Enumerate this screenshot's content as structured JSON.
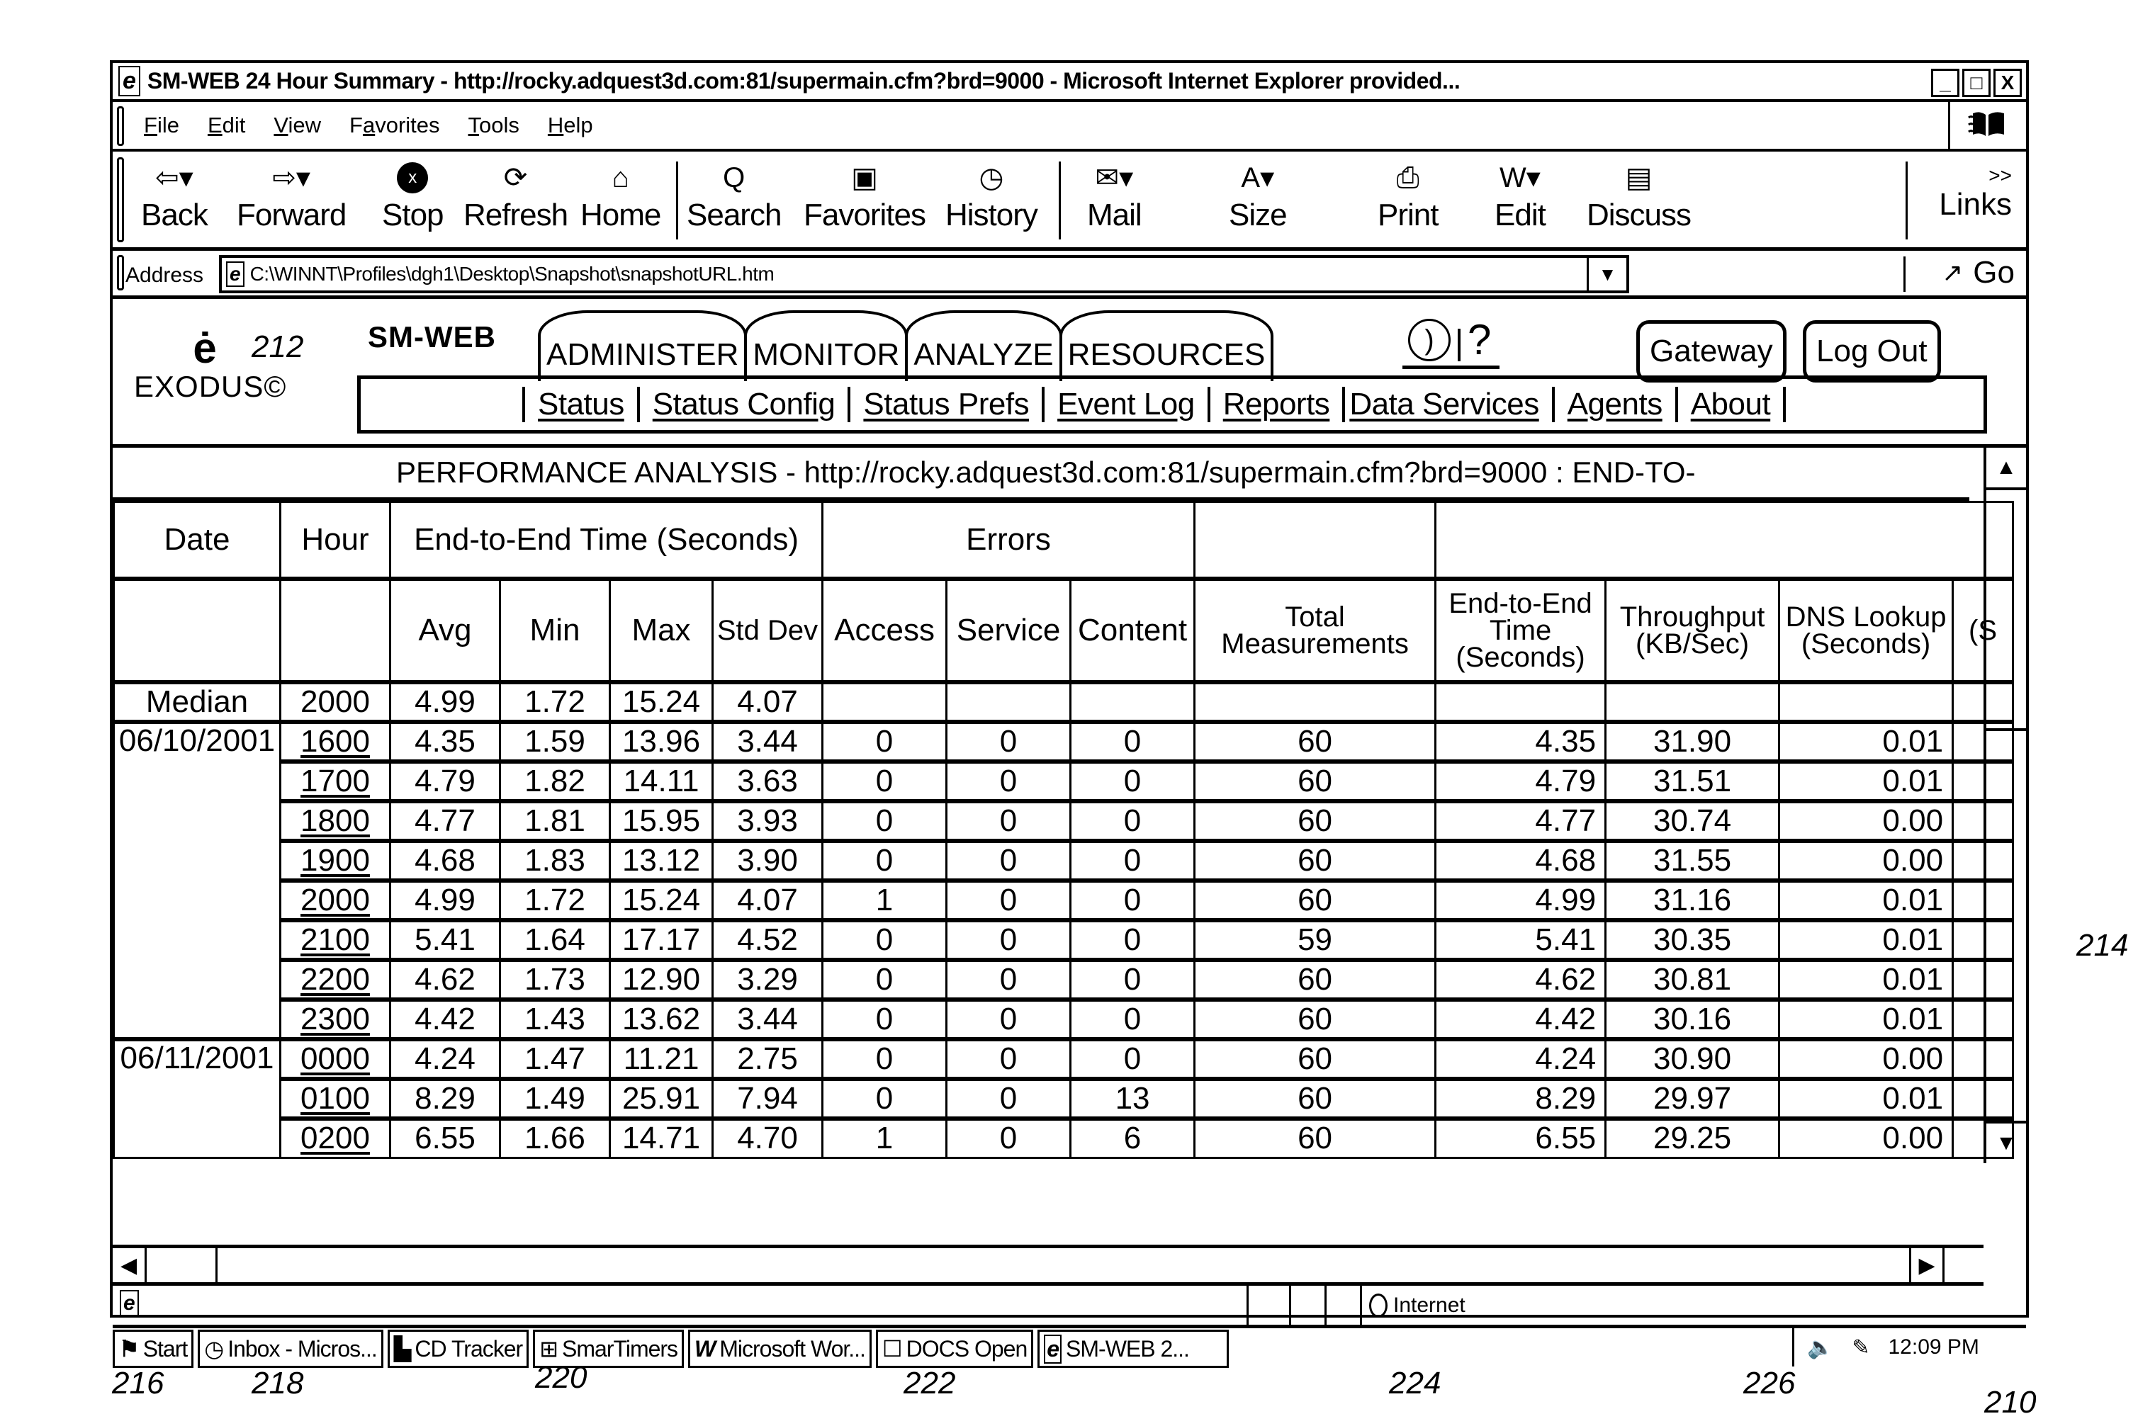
{
  "window": {
    "title": "SM-WEB 24 Hour Summary - http://rocky.adquest3d.com:81/supermain.cfm?brd=9000 - Microsoft Internet Explorer provided...",
    "controls": [
      "_",
      "□",
      "X"
    ]
  },
  "menubar": {
    "items": [
      {
        "label": "File",
        "accel": "F"
      },
      {
        "label": "Edit",
        "accel": "E"
      },
      {
        "label": "View",
        "accel": "V"
      },
      {
        "label": "Favorites",
        "accel": "a"
      },
      {
        "label": "Tools",
        "accel": "T"
      },
      {
        "label": "Help",
        "accel": "H"
      }
    ]
  },
  "toolbar": {
    "buttons": [
      {
        "label": "Back",
        "icon": "back-arrow-icon",
        "glyph": "⇦▾"
      },
      {
        "label": "Forward",
        "icon": "forward-arrow-icon",
        "glyph": "⇨▾"
      },
      {
        "label": "Stop",
        "icon": "stop-icon",
        "glyph": "✖"
      },
      {
        "label": "Refresh",
        "icon": "refresh-icon",
        "glyph": "⟳"
      },
      {
        "label": "Home",
        "icon": "home-icon",
        "glyph": "⌂"
      },
      {
        "label": "Search",
        "icon": "search-icon",
        "glyph": "Q"
      },
      {
        "label": "Favorites",
        "icon": "favorites-icon",
        "glyph": "▣"
      },
      {
        "label": "History",
        "icon": "history-icon",
        "glyph": "◷"
      },
      {
        "label": "Mail",
        "icon": "mail-icon",
        "glyph": "✉▾"
      },
      {
        "label": "Size",
        "icon": "font-size-icon",
        "glyph": "A▾"
      },
      {
        "label": "Print",
        "icon": "printer-icon",
        "glyph": "⎙"
      },
      {
        "label": "Edit",
        "icon": "word-edit-icon",
        "glyph": "W▾"
      },
      {
        "label": "Discuss",
        "icon": "discuss-icon",
        "glyph": "▤"
      }
    ],
    "links_label": "Links",
    "links_chevron": ">>"
  },
  "address": {
    "label": "Address",
    "value": "C:\\WINNT\\Profiles\\dgh1\\Desktop\\Snapshot\\snapshotURL.htm",
    "go_label": "Go"
  },
  "app": {
    "logo_letter": "ė",
    "logo_text": "EXODUS©",
    "brand": "SM-WEB",
    "tabs": [
      "ADMINISTER",
      "MONITOR",
      "ANALYZE",
      "RESOURCES"
    ],
    "active_tab": "MONITOR",
    "help_glyph": "?",
    "gateway_label": "Gateway",
    "logout_label": "Log Out",
    "subnav": [
      "Status",
      "Status Config",
      "Status Prefs",
      "Event Log",
      "Reports",
      "Data Services",
      "Agents",
      "About"
    ]
  },
  "report": {
    "title": "PERFORMANCE ANALYSIS - http://rocky.adquest3d.com:81/supermain.cfm?brd=9000 : END-TO-",
    "group_headers": {
      "date": "Date",
      "hour": "Hour",
      "e2e": "End-to-End Time (Seconds)",
      "errors": "Errors"
    },
    "columns": [
      "Avg",
      "Min",
      "Max",
      "Std Dev",
      "Access",
      "Service",
      "Content",
      "Total Measurements",
      "End-to-End Time (Seconds)",
      "Throughput (KB/Sec)",
      "DNS Lookup (Seconds)",
      "(S"
    ],
    "median": {
      "label": "Median",
      "hour": "2000",
      "avg": "4.99",
      "min": "1.72",
      "max": "15.24",
      "std": "4.07"
    },
    "groups": [
      {
        "date": "06/10/2001",
        "rows": [
          {
            "hour": "1600",
            "avg": "4.35",
            "min": "1.59",
            "max": "13.96",
            "std": "3.44",
            "access": "0",
            "service": "0",
            "content": "0",
            "total": "60",
            "e2e": "4.35",
            "throughput": "31.90",
            "dns": "0.01"
          },
          {
            "hour": "1700",
            "avg": "4.79",
            "min": "1.82",
            "max": "14.11",
            "std": "3.63",
            "access": "0",
            "service": "0",
            "content": "0",
            "total": "60",
            "e2e": "4.79",
            "throughput": "31.51",
            "dns": "0.01"
          },
          {
            "hour": "1800",
            "avg": "4.77",
            "min": "1.81",
            "max": "15.95",
            "std": "3.93",
            "access": "0",
            "service": "0",
            "content": "0",
            "total": "60",
            "e2e": "4.77",
            "throughput": "30.74",
            "dns": "0.00"
          },
          {
            "hour": "1900",
            "avg": "4.68",
            "min": "1.83",
            "max": "13.12",
            "std": "3.90",
            "access": "0",
            "service": "0",
            "content": "0",
            "total": "60",
            "e2e": "4.68",
            "throughput": "31.55",
            "dns": "0.00"
          },
          {
            "hour": "2000",
            "avg": "4.99",
            "min": "1.72",
            "max": "15.24",
            "std": "4.07",
            "access": "1",
            "service": "0",
            "content": "0",
            "total": "60",
            "e2e": "4.99",
            "throughput": "31.16",
            "dns": "0.01"
          },
          {
            "hour": "2100",
            "avg": "5.41",
            "min": "1.64",
            "max": "17.17",
            "std": "4.52",
            "access": "0",
            "service": "0",
            "content": "0",
            "total": "59",
            "e2e": "5.41",
            "throughput": "30.35",
            "dns": "0.01"
          },
          {
            "hour": "2200",
            "avg": "4.62",
            "min": "1.73",
            "max": "12.90",
            "std": "3.29",
            "access": "0",
            "service": "0",
            "content": "0",
            "total": "60",
            "e2e": "4.62",
            "throughput": "30.81",
            "dns": "0.01"
          },
          {
            "hour": "2300",
            "avg": "4.42",
            "min": "1.43",
            "max": "13.62",
            "std": "3.44",
            "access": "0",
            "service": "0",
            "content": "0",
            "total": "60",
            "e2e": "4.42",
            "throughput": "30.16",
            "dns": "0.01"
          }
        ]
      },
      {
        "date": "06/11/2001",
        "rows": [
          {
            "hour": "0000",
            "avg": "4.24",
            "min": "1.47",
            "max": "11.21",
            "std": "2.75",
            "access": "0",
            "service": "0",
            "content": "0",
            "total": "60",
            "e2e": "4.24",
            "throughput": "30.90",
            "dns": "0.00"
          },
          {
            "hour": "0100",
            "avg": "8.29",
            "min": "1.49",
            "max": "25.91",
            "std": "7.94",
            "access": "0",
            "service": "0",
            "content": "13",
            "total": "60",
            "e2e": "8.29",
            "throughput": "29.97",
            "dns": "0.01"
          },
          {
            "hour": "0200",
            "avg": "6.55",
            "min": "1.66",
            "max": "14.71",
            "std": "4.70",
            "access": "1",
            "service": "0",
            "content": "6",
            "total": "60",
            "e2e": "6.55",
            "throughput": "29.25",
            "dns": "0.00"
          }
        ]
      }
    ]
  },
  "statusbar": {
    "zone": "Internet"
  },
  "taskbar": {
    "start": "Start",
    "tasks": [
      "Inbox - Micros...",
      "CD Tracker",
      "SmarTimers",
      "Microsoft Wor...",
      "DOCS Open",
      "SM-WEB 2..."
    ],
    "clock": "12:09 PM"
  },
  "callouts": {
    "c210": "210",
    "c212": "212",
    "c214": "214",
    "c216": "216",
    "c218": "218",
    "c220": "220",
    "c222": "222",
    "c224": "224",
    "c226": "226"
  }
}
